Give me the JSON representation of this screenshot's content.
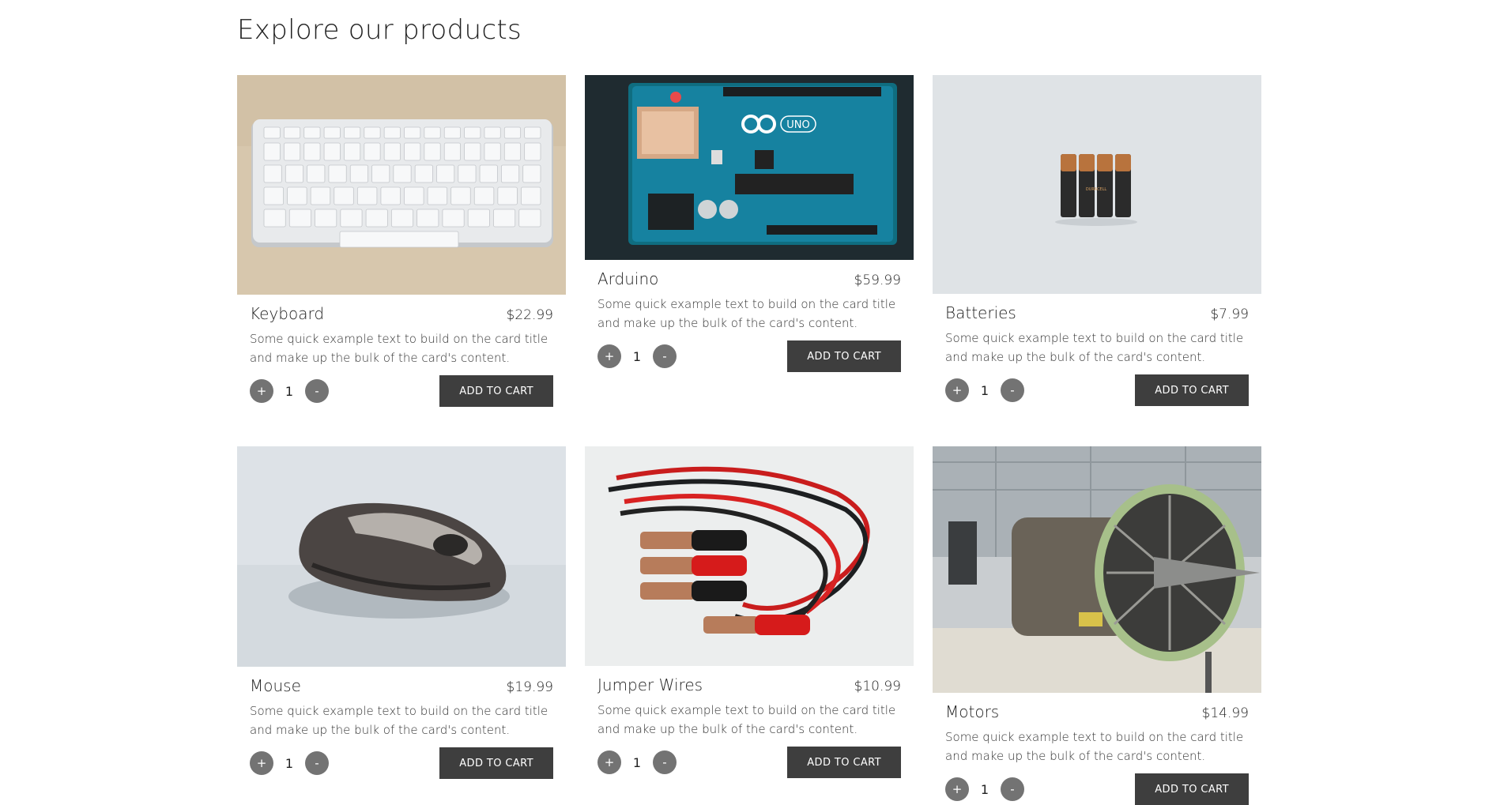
{
  "page": {
    "heading": "Explore our products"
  },
  "products": [
    {
      "title": "Keyboard",
      "price": "$22.99",
      "description": "Some quick example text to build on the card title and make up the bulk of the card's content.",
      "quantity": "1",
      "add_label": "ADD TO CART",
      "plus_label": "+",
      "minus_label": "-"
    },
    {
      "title": "Arduino",
      "price": "$59.99",
      "description": "Some quick example text to build on the card title and make up the bulk of the card's content.",
      "quantity": "1",
      "add_label": "ADD TO CART",
      "plus_label": "+",
      "minus_label": "-"
    },
    {
      "title": "Batteries",
      "price": "$7.99",
      "description": "Some quick example text to build on the card title and make up the bulk of the card's content.",
      "quantity": "1",
      "add_label": "ADD TO CART",
      "plus_label": "+",
      "minus_label": "-"
    },
    {
      "title": "Mouse",
      "price": "$19.99",
      "description": "Some quick example text to build on the card title and make up the bulk of the card's content.",
      "quantity": "1",
      "add_label": "ADD TO CART",
      "plus_label": "+",
      "minus_label": "-"
    },
    {
      "title": "Jumper Wires",
      "price": "$10.99",
      "description": "Some quick example text to build on the card title and make up the bulk of the card's content.",
      "quantity": "1",
      "add_label": "ADD TO CART",
      "plus_label": "+",
      "minus_label": "-"
    },
    {
      "title": "Motors",
      "price": "$14.99",
      "description": "Some quick example text to build on the card title and make up the bulk of the card's content.",
      "quantity": "1",
      "add_label": "ADD TO CART",
      "plus_label": "+",
      "minus_label": "-"
    }
  ],
  "photo_labels": {
    "arduino_brand": "UNO",
    "battery_brand": "DURACELL"
  },
  "colors": {
    "button_bg": "#3e3e3e",
    "stepper_bg": "#737373",
    "text": "#222222"
  }
}
